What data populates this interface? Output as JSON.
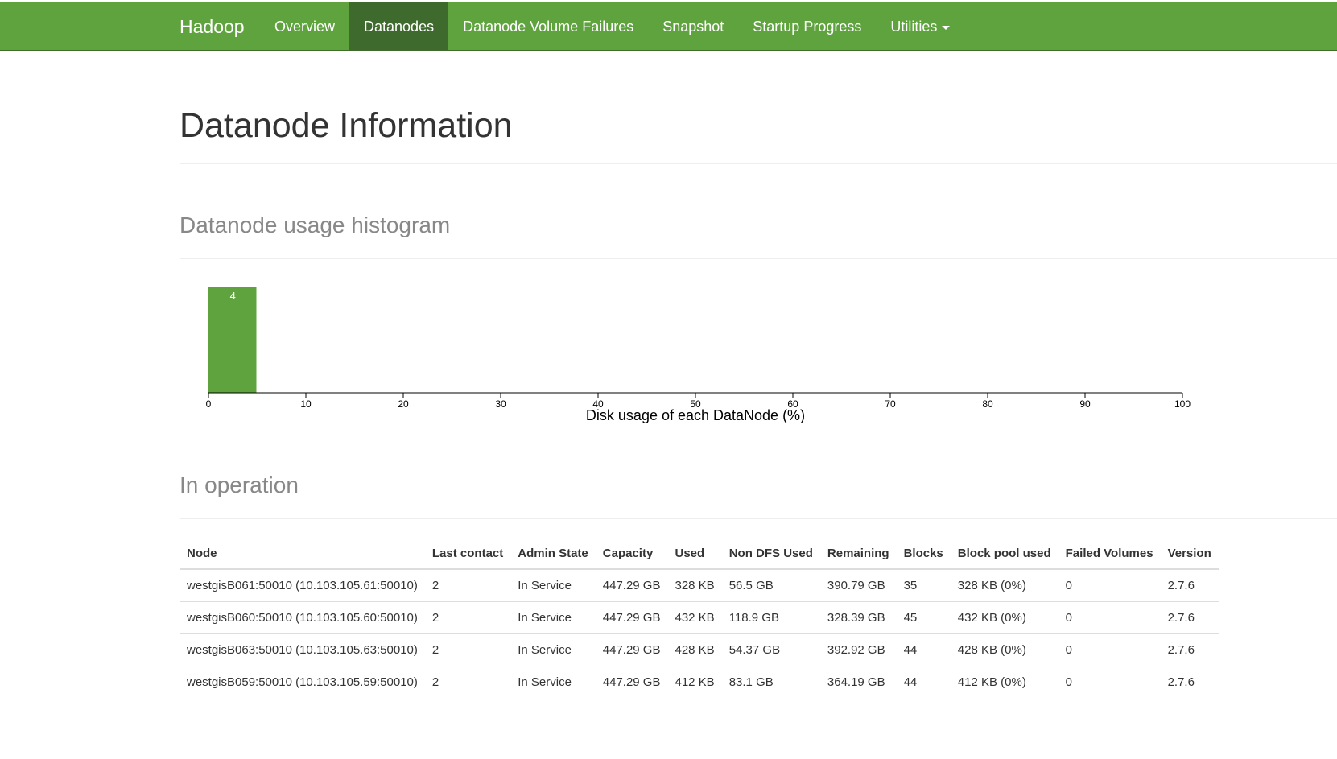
{
  "navbar": {
    "brand": "Hadoop",
    "items": [
      {
        "label": "Overview",
        "active": false
      },
      {
        "label": "Datanodes",
        "active": true
      },
      {
        "label": "Datanode Volume Failures",
        "active": false
      },
      {
        "label": "Snapshot",
        "active": false
      },
      {
        "label": "Startup Progress",
        "active": false
      },
      {
        "label": "Utilities",
        "active": false,
        "dropdown": true
      }
    ],
    "colors": {
      "background": "#5fa33e",
      "active": "#3f6a2e",
      "text": "#ffffff"
    }
  },
  "page": {
    "title": "Datanode Information"
  },
  "histogram": {
    "heading": "Datanode usage histogram",
    "chart_data": {
      "type": "bar",
      "xlabel": "Disk usage of each DataNode (%)",
      "ylabel": "",
      "xlim": [
        0,
        100
      ],
      "xticks": [
        0,
        10,
        20,
        30,
        40,
        50,
        60,
        70,
        80,
        90,
        100
      ],
      "bins": [
        {
          "from": 0,
          "to": 5,
          "count": 4,
          "label": "4"
        }
      ],
      "bar_color": "#5fa33e"
    }
  },
  "in_operation": {
    "heading": "In operation",
    "columns": [
      "Node",
      "Last contact",
      "Admin State",
      "Capacity",
      "Used",
      "Non DFS Used",
      "Remaining",
      "Blocks",
      "Block pool used",
      "Failed Volumes",
      "Version"
    ],
    "rows": [
      [
        "westgisB061:50010 (10.103.105.61:50010)",
        "2",
        "In Service",
        "447.29 GB",
        "328 KB",
        "56.5 GB",
        "390.79 GB",
        "35",
        "328 KB (0%)",
        "0",
        "2.7.6"
      ],
      [
        "westgisB060:50010 (10.103.105.60:50010)",
        "2",
        "In Service",
        "447.29 GB",
        "432 KB",
        "118.9 GB",
        "328.39 GB",
        "45",
        "432 KB (0%)",
        "0",
        "2.7.6"
      ],
      [
        "westgisB063:50010 (10.103.105.63:50010)",
        "2",
        "In Service",
        "447.29 GB",
        "428 KB",
        "54.37 GB",
        "392.92 GB",
        "44",
        "428 KB (0%)",
        "0",
        "2.7.6"
      ],
      [
        "westgisB059:50010 (10.103.105.59:50010)",
        "2",
        "In Service",
        "447.29 GB",
        "412 KB",
        "83.1 GB",
        "364.19 GB",
        "44",
        "412 KB (0%)",
        "0",
        "2.7.6"
      ]
    ]
  }
}
